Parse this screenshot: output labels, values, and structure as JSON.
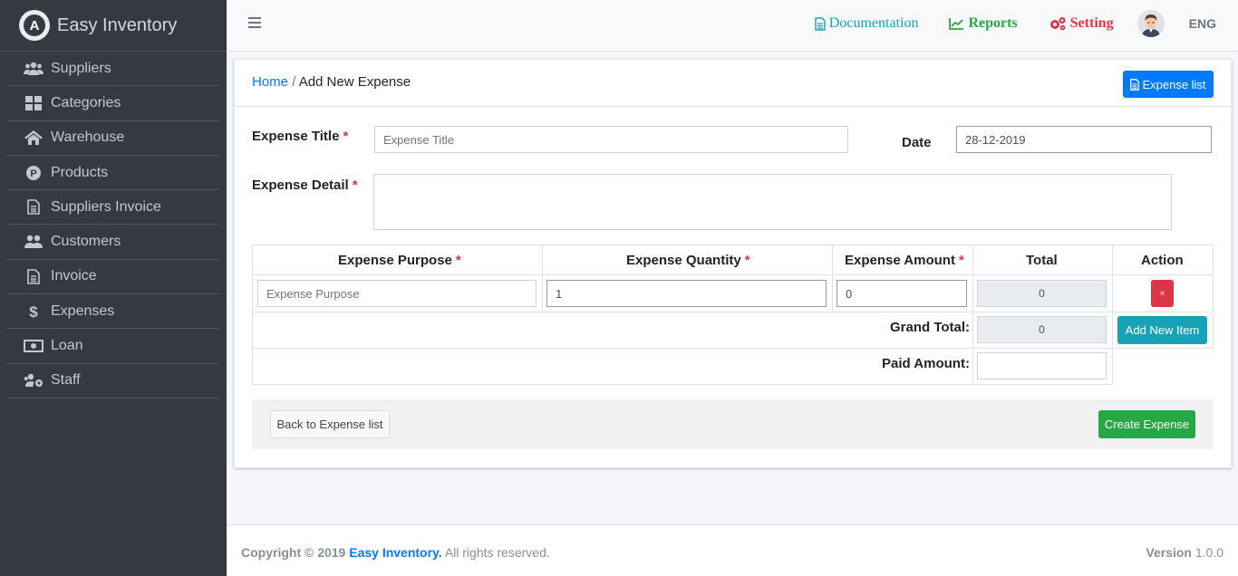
{
  "app": {
    "name": "Easy Inventory",
    "logo_letter": "A"
  },
  "sidebar": {
    "items": [
      {
        "label": "Suppliers",
        "icon": "users-icon"
      },
      {
        "label": "Categories",
        "icon": "grid-icon"
      },
      {
        "label": "Warehouse",
        "icon": "home-icon"
      },
      {
        "label": "Products",
        "icon": "product-p-icon"
      },
      {
        "label": "Suppliers Invoice",
        "icon": "file-icon"
      },
      {
        "label": "Customers",
        "icon": "user-group-icon"
      },
      {
        "label": "Invoice",
        "icon": "file-icon"
      },
      {
        "label": "Expenses",
        "icon": "dollar-icon"
      },
      {
        "label": "Loan",
        "icon": "money-bill-icon"
      },
      {
        "label": "Staff",
        "icon": "users-cog-icon"
      }
    ]
  },
  "topbar": {
    "documentation": "Documentation",
    "reports": "Reports",
    "setting": "Setting",
    "language": "ENG"
  },
  "breadcrumb": {
    "home": "Home",
    "separator": "/",
    "current": "Add New Expense"
  },
  "header": {
    "expense_list_button": "Expense list"
  },
  "form": {
    "expense_title_label": "Expense Title",
    "expense_title_placeholder": "Expense Title",
    "expense_title_value": "",
    "date_label": "Date",
    "date_value": "28-12-2019",
    "expense_detail_label": "Expense Detail",
    "expense_detail_value": "",
    "required_mark": "*"
  },
  "table": {
    "headers": {
      "purpose": "Expense Purpose",
      "quantity": "Expense Quantity",
      "amount": "Expense Amount",
      "total": "Total",
      "action": "Action"
    },
    "rows": [
      {
        "purpose_placeholder": "Expense Purpose",
        "purpose": "",
        "quantity": "1",
        "amount": "0",
        "total": "0",
        "remove_label": "×"
      }
    ],
    "grand_total_label": "Grand Total:",
    "grand_total_value": "0",
    "paid_amount_label": "Paid Amount:",
    "paid_amount_value": "",
    "add_item_button": "Add New Item"
  },
  "actions": {
    "back_button": "Back to Expense list",
    "create_button": "Create Expense"
  },
  "footer": {
    "copyright_prefix": "Copyright © 2019",
    "brand": "Easy Inventory.",
    "rights": "All rights reserved.",
    "version_label": "Version",
    "version_value": "1.0.0"
  },
  "colors": {
    "sidebar_bg": "#343a40",
    "primary": "#007bff",
    "info": "#17a2b8",
    "success": "#28a745",
    "danger": "#dc3545"
  }
}
